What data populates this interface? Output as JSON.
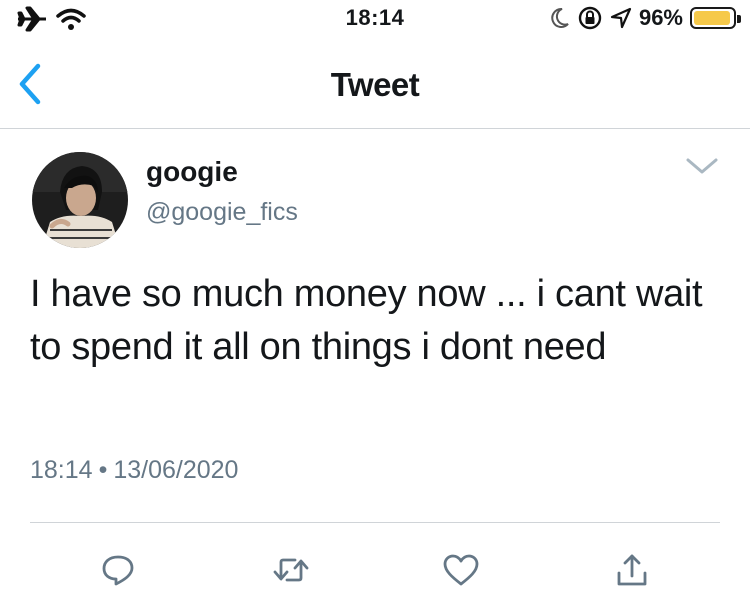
{
  "status_bar": {
    "time": "18:14",
    "battery_percent": "96%",
    "battery_level": 0.96,
    "battery_color": "#f6c94a",
    "icons": [
      "airplane-icon",
      "wifi-icon",
      "moon-icon",
      "orientation-lock-icon",
      "location-icon",
      "battery-icon"
    ]
  },
  "nav": {
    "title": "Tweet",
    "back_icon": "chevron-left-icon",
    "accent": "#1da1f2"
  },
  "tweet": {
    "display_name": "googie",
    "handle": "@googie_fics",
    "text": "I have so much money now ... i cant wait to spend it all on things i dont need",
    "time": "18:14",
    "separator": "•",
    "date": "13/06/2020"
  },
  "actions": [
    {
      "name": "reply-button",
      "icon": "reply-icon"
    },
    {
      "name": "retweet-button",
      "icon": "retweet-icon"
    },
    {
      "name": "like-button",
      "icon": "heart-icon"
    },
    {
      "name": "share-button",
      "icon": "share-icon"
    }
  ],
  "colors": {
    "text": "#14171a",
    "secondary": "#657786",
    "icon": "#657786",
    "divider": "#d0d4d8"
  }
}
